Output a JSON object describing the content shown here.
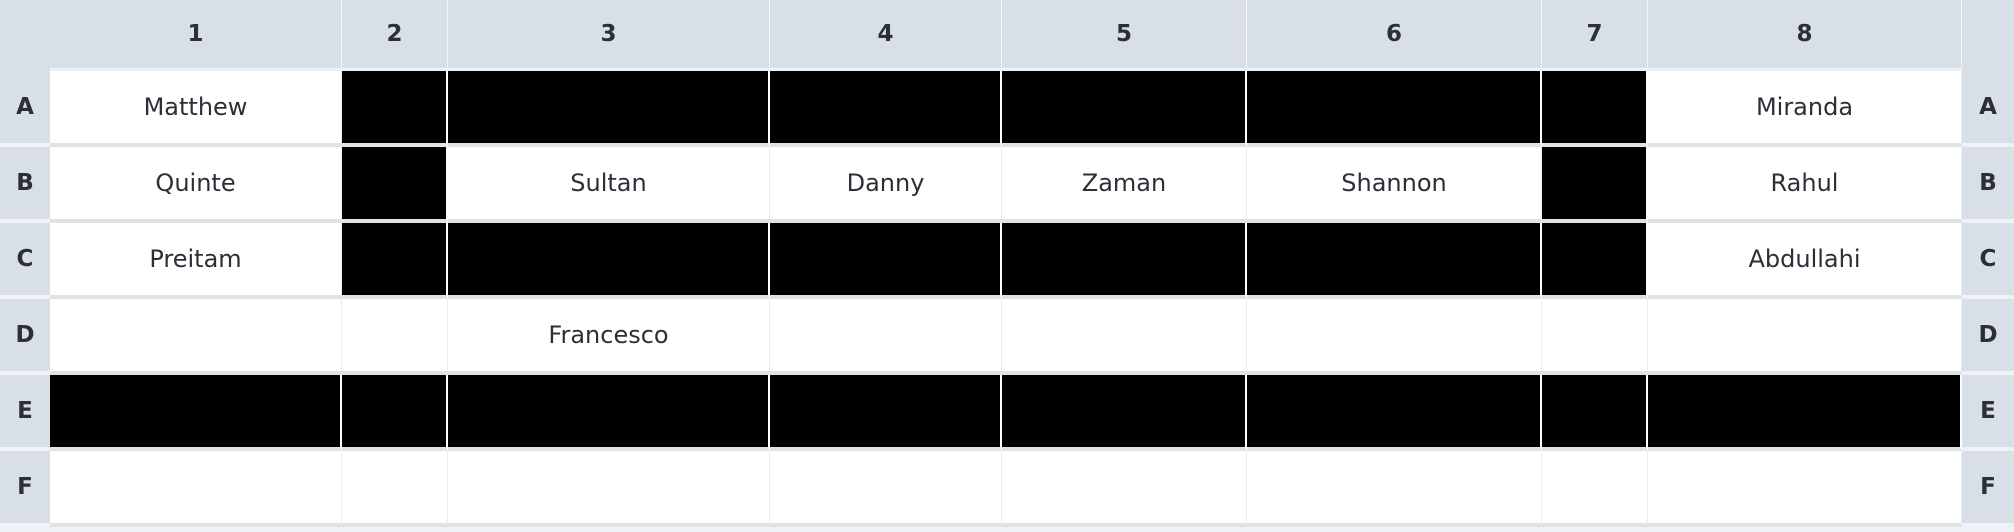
{
  "columns": [
    "1",
    "2",
    "3",
    "4",
    "5",
    "6",
    "7",
    "8"
  ],
  "rows": [
    {
      "label": "A",
      "cells": [
        {
          "text": "Matthew",
          "blocked": false
        },
        {
          "text": "",
          "blocked": true
        },
        {
          "text": "",
          "blocked": true
        },
        {
          "text": "",
          "blocked": true
        },
        {
          "text": "",
          "blocked": true
        },
        {
          "text": "",
          "blocked": true
        },
        {
          "text": "",
          "blocked": true
        },
        {
          "text": "Miranda",
          "blocked": false
        }
      ]
    },
    {
      "label": "B",
      "cells": [
        {
          "text": "Quinte",
          "blocked": false
        },
        {
          "text": "",
          "blocked": true
        },
        {
          "text": "Sultan",
          "blocked": false
        },
        {
          "text": "Danny",
          "blocked": false
        },
        {
          "text": "Zaman",
          "blocked": false
        },
        {
          "text": "Shannon",
          "blocked": false
        },
        {
          "text": "",
          "blocked": true
        },
        {
          "text": "Rahul",
          "blocked": false
        }
      ]
    },
    {
      "label": "C",
      "cells": [
        {
          "text": "Preitam",
          "blocked": false
        },
        {
          "text": "",
          "blocked": true
        },
        {
          "text": "",
          "blocked": true
        },
        {
          "text": "",
          "blocked": true
        },
        {
          "text": "",
          "blocked": true
        },
        {
          "text": "",
          "blocked": true
        },
        {
          "text": "",
          "blocked": true
        },
        {
          "text": "Abdullahi",
          "blocked": false
        }
      ]
    },
    {
      "label": "D",
      "cells": [
        {
          "text": "",
          "blocked": false
        },
        {
          "text": "",
          "blocked": false
        },
        {
          "text": "Francesco",
          "blocked": false
        },
        {
          "text": "",
          "blocked": false
        },
        {
          "text": "",
          "blocked": false
        },
        {
          "text": "",
          "blocked": false
        },
        {
          "text": "",
          "blocked": false
        },
        {
          "text": "",
          "blocked": false
        }
      ]
    },
    {
      "label": "E",
      "cells": [
        {
          "text": "",
          "blocked": true
        },
        {
          "text": "",
          "blocked": true
        },
        {
          "text": "",
          "blocked": true
        },
        {
          "text": "",
          "blocked": true
        },
        {
          "text": "",
          "blocked": true
        },
        {
          "text": "",
          "blocked": true
        },
        {
          "text": "",
          "blocked": true
        },
        {
          "text": "",
          "blocked": true
        }
      ]
    },
    {
      "label": "F",
      "cells": [
        {
          "text": "",
          "blocked": false
        },
        {
          "text": "",
          "blocked": false
        },
        {
          "text": "",
          "blocked": false
        },
        {
          "text": "",
          "blocked": false
        },
        {
          "text": "",
          "blocked": false
        },
        {
          "text": "",
          "blocked": false
        },
        {
          "text": "",
          "blocked": false
        },
        {
          "text": "",
          "blocked": false
        }
      ]
    }
  ],
  "colors": {
    "header_bg": "#d9dfe7",
    "cell_bg": "#ffffff",
    "blocked_bg": "#000000",
    "text": "#2b2f36"
  }
}
